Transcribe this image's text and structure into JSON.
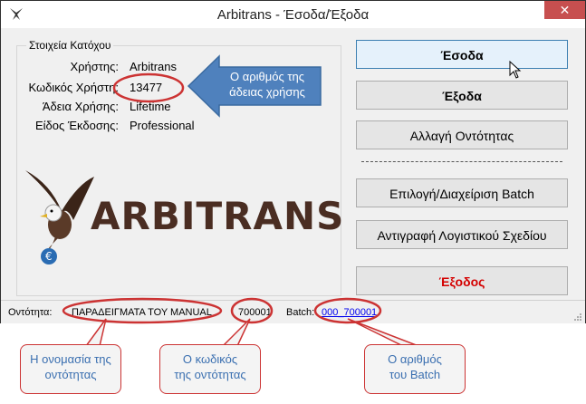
{
  "window": {
    "title": "Arbitrans - Έσοδα/Έξοδα",
    "close_symbol": "✕"
  },
  "owner": {
    "legend": "Στοιχεία Κατόχου",
    "rows": [
      {
        "label": "Χρήστης:",
        "value": "Arbitrans"
      },
      {
        "label": "Κωδικός Χρήστη:",
        "value": "13477"
      },
      {
        "label": "Άδεια Χρήσης:",
        "value": "Lifetime"
      },
      {
        "label": "Είδος Έκδοσης:",
        "value": "Professional"
      }
    ]
  },
  "logo": {
    "text": "ARBITRANS"
  },
  "buttons": {
    "esoda": "Έσοδα",
    "exoda": "Έξοδα",
    "change_entity": "Αλλαγή Οντότητας",
    "batch": "Επιλογή/Διαχείριση Batch",
    "copy_chart": "Αντιγραφή Λογιστικού Σχεδίου",
    "exit": "Έξοδος"
  },
  "status": {
    "entity_label": "Οντότητα:",
    "entity_name": "ΠΑΡΑΔΕΙΓΜΑΤΑ ΤΟΥ MANUAL",
    "entity_code": "700001",
    "batch_label": "Batch:",
    "batch_value": "000_700001"
  },
  "annotations": {
    "arrow": "Ο αριθμός της άδειας χρήσης",
    "entity_name": "Η ονομασία της οντότητας",
    "entity_code": "Ο κωδικός της οντότητας",
    "batch": "Ο αριθμός του Batch"
  },
  "colors": {
    "annotation_red": "#cc3333",
    "arrow_blue": "#4f81bd",
    "exit_red": "#d40000",
    "link_blue": "#0000ee"
  },
  "icons": [
    "app-eagle-icon",
    "close-icon",
    "mouse-cursor-icon",
    "resize-grip-icon"
  ]
}
